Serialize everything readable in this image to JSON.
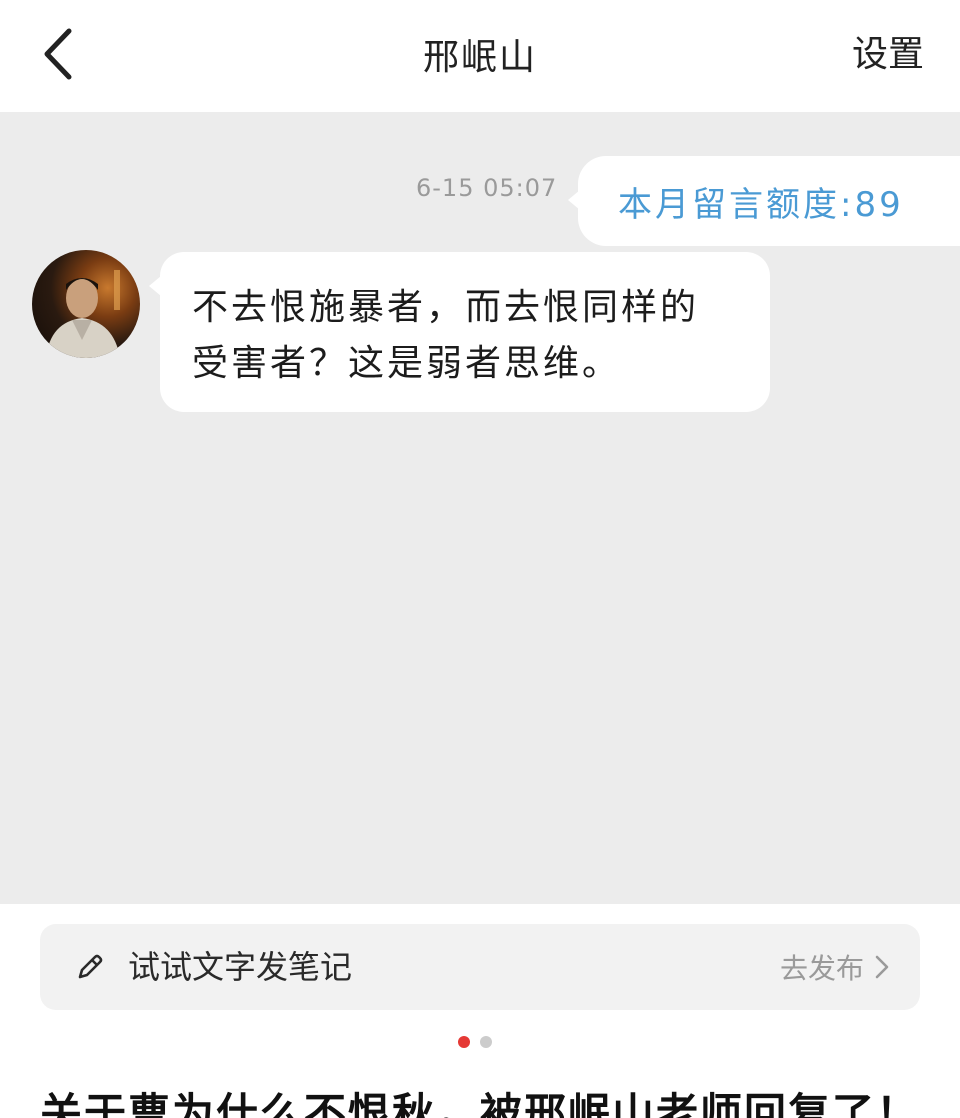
{
  "header": {
    "title": "邢岷山",
    "settings_label": "设置",
    "back_icon": "chevron-left-icon"
  },
  "chat": {
    "messages": [
      {
        "side": "right",
        "timestamp": "6-15 05:07",
        "text": "本月留言额度:89",
        "color": "#4a9ad4"
      },
      {
        "side": "left",
        "lines": [
          "不去恨施暴者，而去恨同样的",
          "受害者？这是弱者思维。"
        ]
      }
    ]
  },
  "compose": {
    "icon": "pencil-icon",
    "label": "试试文字发笔记",
    "publish_label": "去发布",
    "publish_icon": "chevron-right-icon"
  },
  "pagination": {
    "total": 2,
    "active": 1,
    "active_color": "#e53935",
    "inactive_color": "#cccccc"
  },
  "post": {
    "title": "关于曹为什么不恨秋，被邢岷山老师回复了！"
  },
  "colors": {
    "chat_background": "#ececec",
    "accent_blue": "#4a9ad4",
    "accent_red": "#e53935"
  }
}
